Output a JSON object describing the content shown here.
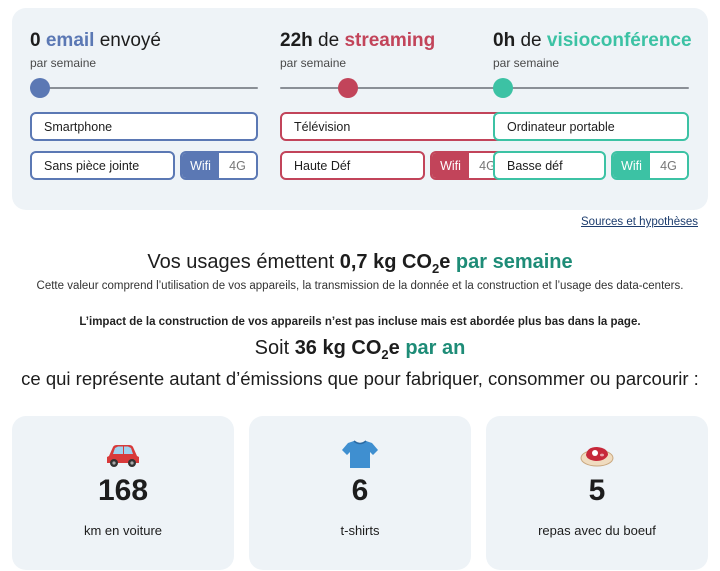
{
  "usages": [
    {
      "count": "0",
      "keyword": "email",
      "rest": "envoyé",
      "subtitle": "par semaine",
      "slider_fraction": 0,
      "device": "Smartphone",
      "quality": "Sans pièce jointe",
      "network_selected": "Wifi",
      "network_other": "4G",
      "color": "#5b78b4"
    },
    {
      "count": "22h",
      "connector": "de",
      "keyword": "streaming",
      "subtitle": "par semaine",
      "slider_fraction": 0.28,
      "device": "Télévision",
      "quality": "Haute Déf",
      "network_selected": "Wifi",
      "network_other": "4G",
      "color": "#c2445a"
    },
    {
      "count": "0h",
      "connector": "de",
      "keyword": "visioconférence",
      "subtitle": "par semaine",
      "slider_fraction": 0,
      "device": "Ordinateur portable",
      "quality": "Basse déf",
      "network_selected": "Wifi",
      "network_other": "4G",
      "color": "#3cc2a4"
    }
  ],
  "sources_link": "Sources et hypothèses",
  "result": {
    "prefix": "Vos usages émettent",
    "value": "0,7 kg CO",
    "sub": "2",
    "suffix": "e",
    "period": "par semaine",
    "note": "Cette valeur comprend l’utilisation de vos appareils, la transmission de la donnée et la construction et l’usage des data-centers.",
    "note_bold": "L’impact de la construction de vos appareils n’est pas incluse mais est abordée plus bas dans la page.",
    "year_prefix": "Soit",
    "year_value": "36 kg CO",
    "year_sub": "2",
    "year_suffix": "e",
    "year_period": "par an",
    "compare_text": "ce qui représente autant d’émissions que pour fabriquer, consommer ou parcourir :"
  },
  "equivalents": [
    {
      "icon": "car-icon",
      "value": "168",
      "label": "km en voiture"
    },
    {
      "icon": "tshirt-icon",
      "value": "6",
      "label": "t-shirts"
    },
    {
      "icon": "beef-meal-icon",
      "value": "5",
      "label": "repas avec du boeuf"
    }
  ]
}
